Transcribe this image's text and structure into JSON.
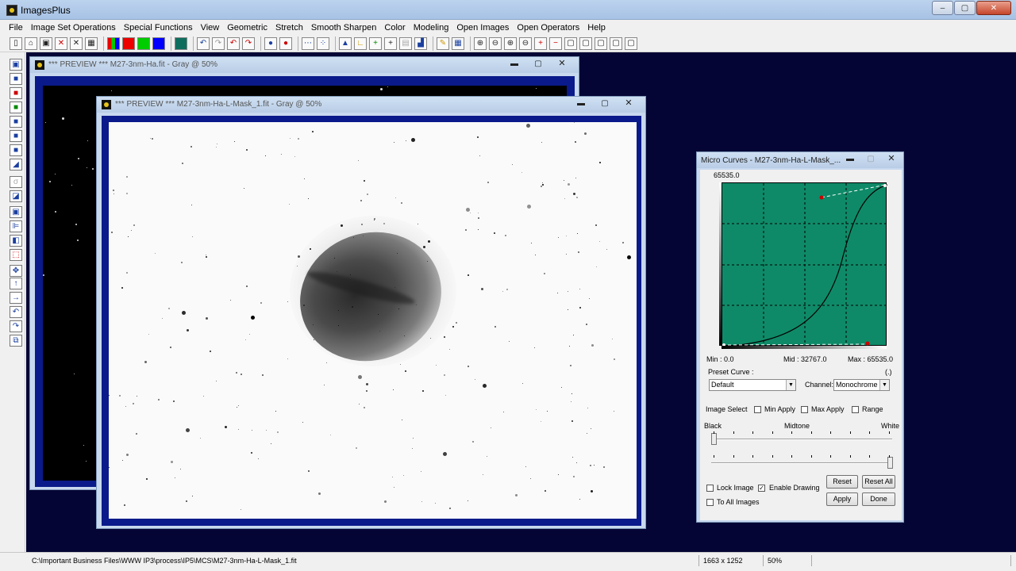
{
  "app": {
    "title": "ImagesPlus"
  },
  "menu": [
    "File",
    "Image Set Operations",
    "Special Functions",
    "View",
    "Geometric",
    "Stretch",
    "Smooth Sharpen",
    "Color",
    "Modeling",
    "Open Images",
    "Open Operators",
    "Help"
  ],
  "window_buttons": {
    "min": "‒",
    "max": "▢",
    "close": "✕"
  },
  "child_buttons": {
    "min": "▬",
    "max": "▢",
    "close": "✕"
  },
  "preview_back": {
    "title": "*** PREVIEW *** M27-3nm-Ha.fit - Gray @ 50%"
  },
  "preview_front": {
    "title": "*** PREVIEW *** M27-3nm-Ha-L-Mask_1.fit - Gray @ 50%"
  },
  "micro_curves": {
    "title": "Micro Curves - M27-3nm-Ha-L-Mask_...",
    "top_value": "65535.0",
    "min_label": "Min : 0.0",
    "mid_label": "Mid : 32767.0",
    "max_label": "Max : 65535.0",
    "preset_label": "Preset Curve :",
    "paren_label": "(.)",
    "preset_value": "Default",
    "channel_label": "Channel:",
    "channel_value": "Monochrome",
    "image_select": "Image Select",
    "min_apply": "Min Apply",
    "max_apply": "Max Apply",
    "range": "Range",
    "black": "Black",
    "midtone": "Midtone",
    "white": "White",
    "lock_image": "Lock Image",
    "enable_drawing": "Enable Drawing",
    "to_all_images": "To All Images",
    "reset": "Reset",
    "reset_all": "Reset All",
    "apply": "Apply",
    "done": "Done",
    "enable_drawing_checked": "✓"
  },
  "status": {
    "path": "C:\\Important Business Files\\WWW IP3\\process\\IP5\\MCS\\M27-3nm-Ha-L-Mask_1.fit",
    "dims": "1663 x 1252",
    "zoom": "50%"
  }
}
